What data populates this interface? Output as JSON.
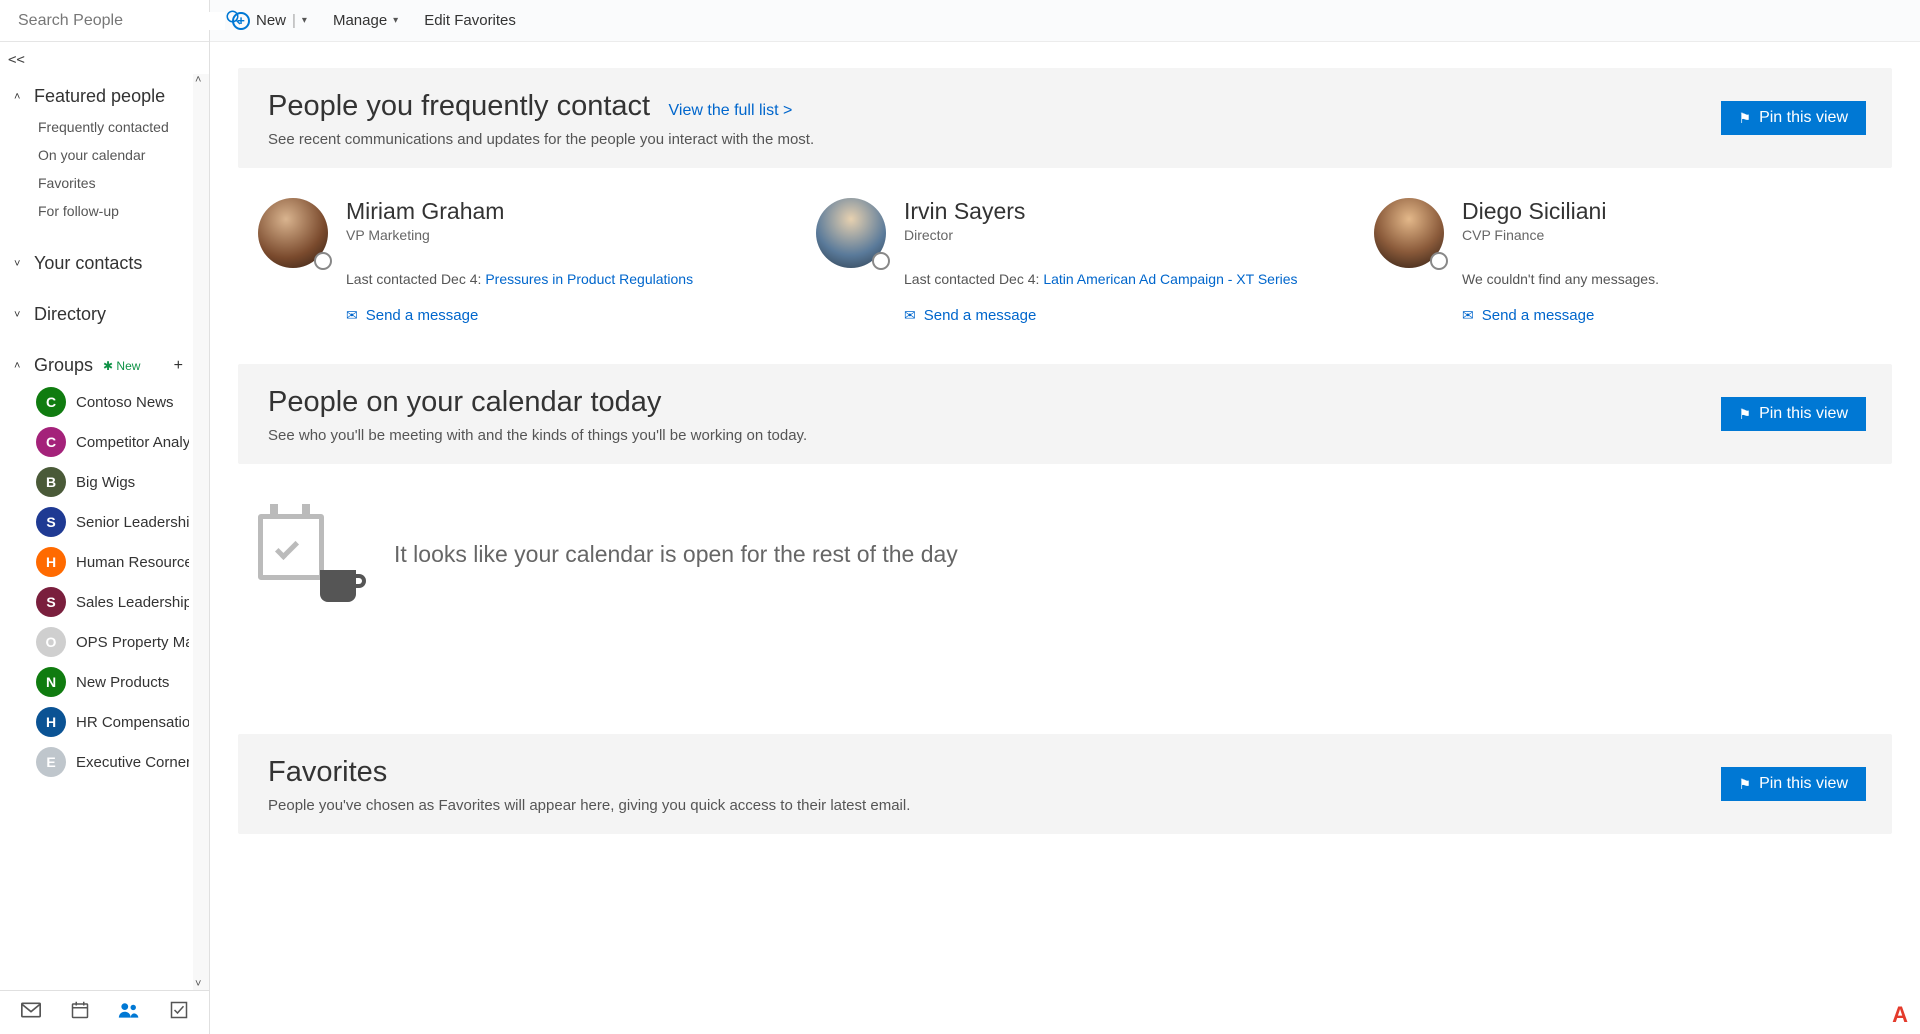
{
  "search": {
    "placeholder": "Search People"
  },
  "sidebar": {
    "featured": {
      "title": "Featured people",
      "items": [
        "Frequently contacted",
        "On your calendar",
        "Favorites",
        "For follow-up"
      ]
    },
    "your_contacts": "Your contacts",
    "directory": "Directory",
    "groups": {
      "title": "Groups",
      "new_badge": "New",
      "items": [
        {
          "label": "Contoso News",
          "color": "#107c10"
        },
        {
          "label": "Competitor Analysis",
          "color": "#a4227a"
        },
        {
          "label": "Big Wigs",
          "color": "#4a5a38"
        },
        {
          "label": "Senior Leadership T",
          "color": "#1f3a93"
        },
        {
          "label": "Human Resources",
          "color": "#ff6a00"
        },
        {
          "label": "Sales Leadership",
          "color": "#7a1f3d"
        },
        {
          "label": "OPS Property Mana",
          "color": "#cfcfcf"
        },
        {
          "label": "New Products",
          "color": "#107c10"
        },
        {
          "label": "HR Compensation",
          "color": "#0b5394"
        },
        {
          "label": "Executive Corner",
          "color": "#bfc6cc"
        }
      ]
    }
  },
  "toolbar": {
    "new_label": "New",
    "manage_label": "Manage",
    "edit_favorites_label": "Edit Favorites"
  },
  "frequent": {
    "heading": "People you frequently contact",
    "view_full": "View the full list >",
    "sub": "See recent communications and updates for the people you interact with the most.",
    "pin": "Pin this view",
    "people": [
      {
        "name": "Miriam Graham",
        "title": "VP Marketing",
        "last_prefix": "Last contacted Dec 4: ",
        "last_link": "Pressures in Product Regulations",
        "send": "Send a message"
      },
      {
        "name": "Irvin Sayers",
        "title": "Director",
        "last_prefix": "Last contacted Dec 4: ",
        "last_link": "Latin American Ad Campaign - XT Series",
        "send": "Send a message"
      },
      {
        "name": "Diego Siciliani",
        "title": "CVP Finance",
        "no_msg": "We couldn't find any messages.",
        "send": "Send a message"
      }
    ]
  },
  "calendar": {
    "heading": "People on your calendar today",
    "sub": "See who you'll be meeting with and the kinds of things you'll be working on today.",
    "pin": "Pin this view",
    "empty": "It looks like your calendar is open for the rest of the day"
  },
  "favorites": {
    "heading": "Favorites",
    "sub": "People you've chosen as Favorites will appear here, giving you quick access to their latest email.",
    "pin": "Pin this view"
  },
  "avatars": {
    "miriam": "radial-gradient(circle at 40% 30%, #d9b48f 0%, #7a4a2d 60%, #2b1b12 100%)",
    "irvin": "radial-gradient(circle at 50% 30%, #e7d1b0 0%, #5a7a9a 60%, #2b3b4a 100%)",
    "diego": "radial-gradient(circle at 50% 30%, #e3b88a 0%, #8a5a3a 55%, #2b1b12 100%)"
  }
}
